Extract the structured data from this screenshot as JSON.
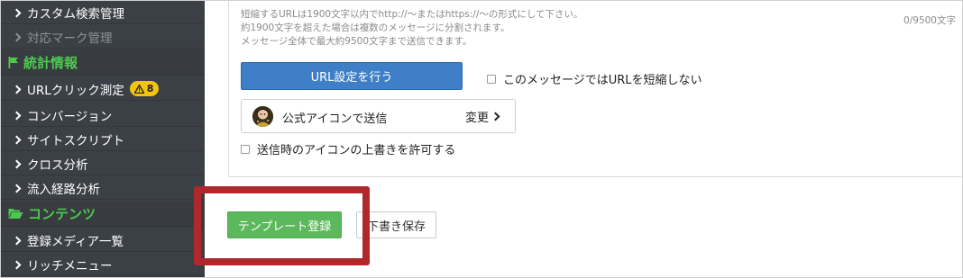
{
  "sidebar": {
    "items": [
      {
        "label": "カスタム検索管理",
        "disabled": false
      },
      {
        "label": "対応マーク管理",
        "disabled": true
      }
    ],
    "section_stats": {
      "label": "統計情報",
      "icon": "flag-icon",
      "color": "#4ec94e"
    },
    "stats_items": [
      {
        "label": "URLクリック測定",
        "badge": "8",
        "badge_icon": "warning-icon"
      },
      {
        "label": "コンバージョン"
      },
      {
        "label": "サイトスクリプト"
      },
      {
        "label": "クロス分析"
      },
      {
        "label": "流入経路分析"
      }
    ],
    "section_contents": {
      "label": "コンテンツ",
      "icon": "folder-open-icon",
      "color": "#4ec94e"
    },
    "contents_items": [
      {
        "label": "登録メディア一覧"
      },
      {
        "label": "リッチメニュー"
      }
    ]
  },
  "main": {
    "help_lines": [
      "短縮するURLは1900文字以内でhttp://〜またはhttps://〜の形式にして下さい。",
      "約1900文字を超えた場合は複数のメッセージに分割されます。",
      "メッセージ全体で最大約9500文字まで送信できます。"
    ],
    "char_counter": "0/9500文字",
    "url_button": "URL設定を行う",
    "no_shorten_label": "このメッセージではURLを短縮しない",
    "icon_send_label": "公式アイコンで送信",
    "change_label": "変更",
    "allow_override_label": "送信時のアイコンの上書きを許可する",
    "template_button": "テンプレート登録",
    "draft_button": "下書き保存"
  },
  "colors": {
    "sidebar_bg": "#3b4046",
    "section_green": "#4ec94e",
    "primary_blue": "#3f7fc8",
    "success_green": "#5cb85c",
    "warning_yellow": "#f2c40f",
    "highlight_red": "#b0282c"
  }
}
